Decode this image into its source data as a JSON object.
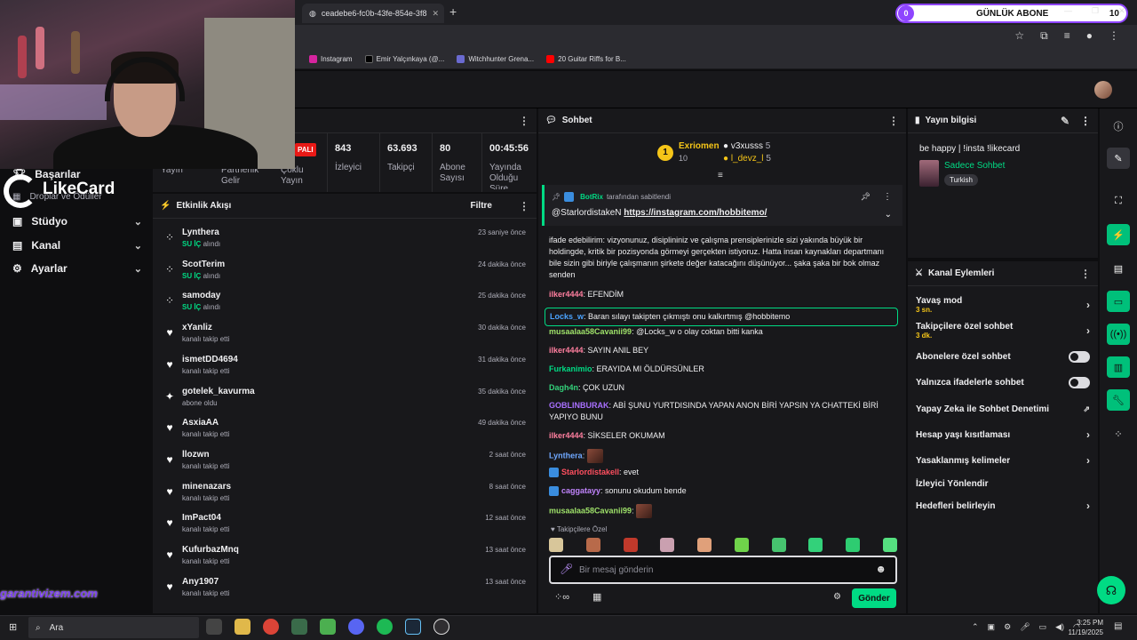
{
  "browser": {
    "tab_title": "ceadebe6-fc0b-43fe-854e-3f8",
    "bookmarks": [
      "Instagram",
      "Emir Yalçınkaya (@...",
      "Witchhunter Grena...",
      "20 Guitar Riffs for B..."
    ]
  },
  "abone_widget": {
    "count": "0",
    "label": "GÜNLÜK ABONE",
    "goal": "10"
  },
  "sidebar": {
    "items": [
      {
        "label": "Başarılar"
      },
      {
        "label": "Ödüller"
      },
      {
        "label": "Stüdyo"
      },
      {
        "label": "Kanal"
      },
      {
        "label": "Ayarlar"
      }
    ],
    "partial_label": "Droplar ve Ödüller"
  },
  "stats": {
    "live_badge": "PALI",
    "viewers_value": "843",
    "viewers_label": "İzleyici",
    "followers_value": "63.693",
    "followers_label": "Takipçi",
    "subs_value": "80",
    "subs_label": "Abone Sayısı",
    "uptime_value": "00:45:56",
    "uptime_label": "Yayında Olduğu Süre",
    "row2": [
      "Yayın",
      "Partnerlik Gelir",
      "Çoklu Yayın"
    ]
  },
  "activity": {
    "title": "Etkinlik Akışı",
    "filter": "Filtre",
    "items": [
      {
        "name": "Lynthera",
        "sub_b": "SU İÇ",
        "sub": "alındı",
        "time": "23 saniye önce",
        "icon": "points-icon"
      },
      {
        "name": "ScotTerim",
        "sub_b": "SU İÇ",
        "sub": "alındı",
        "time": "24 dakika önce",
        "icon": "points-icon"
      },
      {
        "name": "samoday",
        "sub_b": "SU İÇ",
        "sub": "alındı",
        "time": "25 dakika önce",
        "icon": "points-icon"
      },
      {
        "name": "xYanliz",
        "sub_b": "",
        "sub": "kanalı takip etti",
        "time": "30 dakika önce",
        "icon": "heart-icon"
      },
      {
        "name": "ismetDD4694",
        "sub_b": "",
        "sub": "kanalı takip etti",
        "time": "31 dakika önce",
        "icon": "heart-icon"
      },
      {
        "name": "gotelek_kavurma",
        "sub_b": "",
        "sub": "abone oldu",
        "time": "35 dakika önce",
        "icon": "star-icon"
      },
      {
        "name": "AsxiaAA",
        "sub_b": "",
        "sub": "kanalı takip etti",
        "time": "49 dakika önce",
        "icon": "heart-icon"
      },
      {
        "name": "llozwn",
        "sub_b": "",
        "sub": "kanalı takip etti",
        "time": "2 saat önce",
        "icon": "heart-icon"
      },
      {
        "name": "minenazars",
        "sub_b": "",
        "sub": "kanalı takip etti",
        "time": "8 saat önce",
        "icon": "heart-icon"
      },
      {
        "name": "ImPact04",
        "sub_b": "",
        "sub": "kanalı takip etti",
        "time": "12 saat önce",
        "icon": "heart-icon"
      },
      {
        "name": "KufurbazMnq",
        "sub_b": "",
        "sub": "kanalı takip etti",
        "time": "13 saat önce",
        "icon": "heart-icon"
      },
      {
        "name": "Any1907",
        "sub_b": "",
        "sub": "kanalı takip etti",
        "time": "13 saat önce",
        "icon": "heart-icon"
      }
    ]
  },
  "chat": {
    "title": "Sohbet",
    "leaderboard": {
      "first_name": "Exriomen",
      "first_count": "10",
      "r1_name": "v3xusss",
      "r1_count": "5",
      "r2_name": "l_devz_l",
      "r2_count": "5"
    },
    "pinned": {
      "by": "BotRix",
      "by_suffix": "tarafından sabitlendi",
      "mention": "@StarlordistakeN",
      "link": "https://instagram.com/hobbitemo/"
    },
    "cut_message": "ifade edebilirim: vizyonunuz, disiplininiz ve çalışma prensiplerinizle sizi yakında büyük bir holdingde, kritik bir pozisyonda görmeyi gerçekten istiyoruz. Hatta insan kaynakları departmanı bile sizin gibi biriyle çalışmanın şirkete değer katacağını düşünüyor... şaka şaka bir bok olmaz senden",
    "messages": [
      {
        "user": "ilker4444",
        "color": "#ff7f9f",
        "text": ": EFENDİM"
      },
      {
        "user": "Locks_w",
        "color": "#4aa3ff",
        "text": ": Baran sılayı takipten çıkmıştı onu kalkırtmış @hobbitemo"
      },
      {
        "user": "musaalaa58Cavanii99",
        "color": "#9fe26a",
        "text": ": @Locks_w o olay coktan bitti kanka"
      },
      {
        "user": "ilker4444",
        "color": "#ff7f9f",
        "text": ": SAYIN ANIL BEY"
      },
      {
        "user": "Furkanimio",
        "color": "#00db84",
        "text": ": ERAYIDA MI ÖLDÜRSÜNLER"
      },
      {
        "user": "Dagh4n",
        "color": "#33d17a",
        "text": ": ÇOK UZUN"
      },
      {
        "user": "GOBLINBURAK",
        "color": "#a970ff",
        "text": ": ABİ ŞUNU YURTDISINDA YAPAN ANON BİRİ YAPSIN YA CHATTEKİ BİRİ YAPIYO BUNU"
      },
      {
        "user": "ilker4444",
        "color": "#ff7f9f",
        "text": ": SİKSELER OKUMAM"
      },
      {
        "user": "Lynthera",
        "color": "#6fa8ff",
        "text": ":"
      },
      {
        "user": "Starlordistakell",
        "color": "#ff4f5f",
        "text": ": evet"
      },
      {
        "user": "caggatayy",
        "color": "#c084fc",
        "text": ": sonunu okudum bende"
      },
      {
        "user": "musaalaa58Cavanii99",
        "color": "#9fe26a",
        "text": ":"
      }
    ],
    "followers_only": "Takipçilere Özel",
    "input_placeholder": "Bir mesaj gönderin",
    "send": "Gönder"
  },
  "stream_info": {
    "title": "Yayın bilgisi",
    "stream_title": "be happy | !insta !likecard",
    "category": "Sadece Sohbet",
    "tag": "Turkish"
  },
  "channel_actions": {
    "title": "Kanal Eylemleri",
    "slow_mode": "Yavaş mod",
    "slow_mode_val": "3 sn.",
    "followers_chat": "Takipçilere özel sohbet",
    "followers_chat_val": "3 dk.",
    "subs_chat": "Abonelere özel sohbet",
    "emote_chat": "Yalnızca ifadelerle sohbet",
    "ai_mod": "Yapay Zeka ile Sohbet Denetimi",
    "age": "Hesap yaşı kısıtlaması",
    "banned_words": "Yasaklanmış kelimeler",
    "raid": "İzleyici Yönlendir",
    "goals": "Hedefleri belirleyin"
  },
  "overlay": {
    "likecard": "LikeCard",
    "garanti": "garantivizem.com"
  },
  "taskbar": {
    "search": "Ara",
    "time": "3:25 PM",
    "date": "11/19/2025"
  },
  "colors": {
    "accent": "#00db84",
    "purple": "#8e44ff",
    "bg": "#18181b"
  }
}
